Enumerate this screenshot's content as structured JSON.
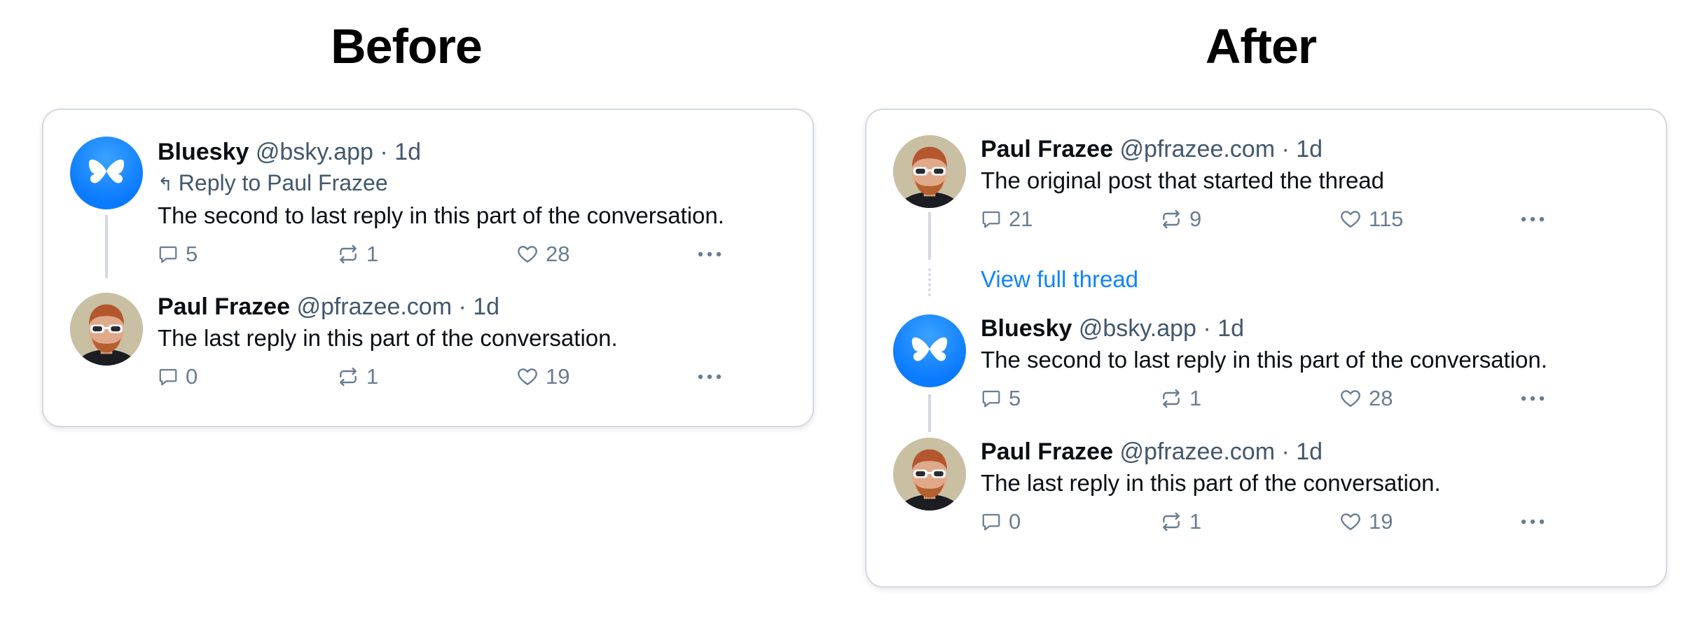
{
  "headings": {
    "before": "Before",
    "after": "After"
  },
  "before_card": {
    "posts": [
      {
        "avatar": "bluesky-logo-icon",
        "name": "Bluesky",
        "handle": "@bsky.app",
        "time": "· 1d",
        "reply_to": "Reply to Paul Frazee",
        "text": "The second to last reply in this part of the conversation.",
        "comments": "5",
        "reposts": "1",
        "likes": "28"
      },
      {
        "avatar": "paul-frazee-avatar",
        "name": "Paul Frazee",
        "handle": "@pfrazee.com",
        "time": "· 1d",
        "text": "The last reply in this part of the conversation.",
        "comments": "0",
        "reposts": "1",
        "likes": "19"
      }
    ]
  },
  "after_card": {
    "posts": [
      {
        "avatar": "paul-frazee-avatar",
        "name": "Paul Frazee",
        "handle": "@pfrazee.com",
        "time": "· 1d",
        "text": "The original post that started the thread",
        "comments": "21",
        "reposts": "9",
        "likes": "115"
      },
      {
        "avatar": "bluesky-logo-icon",
        "name": "Bluesky",
        "handle": "@bsky.app",
        "time": "· 1d",
        "text": "The second to last reply in this part of the conversation.",
        "comments": "5",
        "reposts": "1",
        "likes": "28"
      },
      {
        "avatar": "paul-frazee-avatar",
        "name": "Paul Frazee",
        "handle": "@pfrazee.com",
        "time": "· 1d",
        "text": "The last reply in this part of the conversation.",
        "comments": "0",
        "reposts": "1",
        "likes": "19"
      }
    ],
    "view_full_thread": "View full thread"
  },
  "colors": {
    "link": "#1083fe",
    "meta": "#42576c",
    "icon": "#6a7d91",
    "bluesky": "#0a7aff"
  },
  "icons": [
    "comment-icon",
    "repost-icon",
    "heart-icon",
    "more-icon",
    "reply-arrow-icon"
  ]
}
